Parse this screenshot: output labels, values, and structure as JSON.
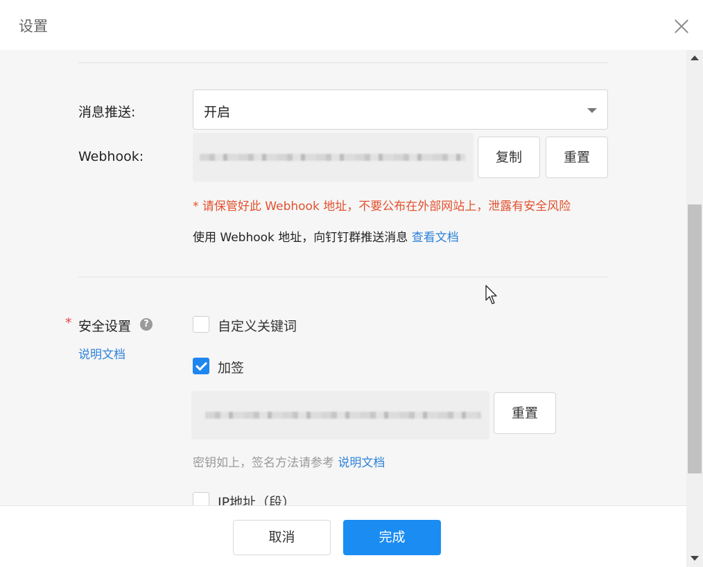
{
  "dialog": {
    "title": "设置"
  },
  "push": {
    "label": "消息推送:",
    "select_value": "开启"
  },
  "webhook": {
    "label": "Webhook:",
    "copy_button": "复制",
    "reset_button": "重置",
    "warning": "* 请保管好此 Webhook 地址，不要公布在外部网站上，泄露有安全风险",
    "info_text": "使用 Webhook 地址，向钉钉群推送消息",
    "info_link": "查看文档"
  },
  "security": {
    "required_mark": "*",
    "label": "安全设置",
    "help_icon": "?",
    "doc_link": "说明文档",
    "options": [
      {
        "label": "自定义关键词",
        "checked": false
      },
      {
        "label": "加签",
        "checked": true
      },
      {
        "label": "IP地址（段）",
        "checked": false
      }
    ],
    "sign_reset_button": "重置",
    "hint_text": "密钥如上，签名方法请参考",
    "hint_link": "说明文档"
  },
  "footer": {
    "cancel_button": "取消",
    "done_button": "完成"
  },
  "colors": {
    "primary": "#1b8cf2",
    "warning": "#e2512f",
    "link": "#2f82d9",
    "required": "#e64545"
  },
  "icons": [
    "close-icon",
    "chevron-down-icon",
    "help-circle-icon",
    "check-icon",
    "scroll-up-arrow-icon",
    "scroll-down-arrow-icon",
    "mouse-pointer-icon"
  ]
}
